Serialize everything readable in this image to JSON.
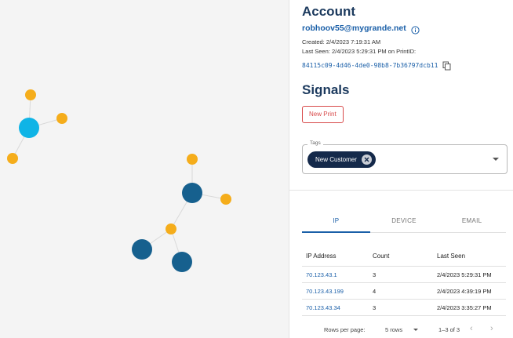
{
  "account": {
    "heading": "Account",
    "email": "robhoov55@mygrande.net",
    "created": "Created: 2/4/2023 7:19:31 AM",
    "last_seen": "Last Seen: 2/4/2023 5:29:31 PM on PrintID:",
    "print_id": "84115c09-4d46-4de0-98b8-7b36797dcb11"
  },
  "signals": {
    "heading": "Signals",
    "new_print_label": "New Print",
    "tags_label": "Tags",
    "tags": [
      "New Customer"
    ]
  },
  "tabs": [
    {
      "label": "IP",
      "active": true
    },
    {
      "label": "DEVICE",
      "active": false
    },
    {
      "label": "EMAIL",
      "active": false
    }
  ],
  "table": {
    "headers": [
      "IP Address",
      "Count",
      "Last Seen"
    ],
    "rows": [
      {
        "ip": "70.123.43.1",
        "count": "3",
        "last_seen": "2/4/2023 5:29:31 PM"
      },
      {
        "ip": "70.123.43.199",
        "count": "4",
        "last_seen": "2/4/2023 4:39:19 PM"
      },
      {
        "ip": "70.123.43.34",
        "count": "3",
        "last_seen": "2/4/2023 3:35:27 PM"
      }
    ]
  },
  "pagination": {
    "rows_per_page_label": "Rows per page:",
    "rows_value": "5 rows",
    "range": "1–3 of 3"
  },
  "colors": {
    "primary_node": "#0fb4e6",
    "secondary_node": "#16608e",
    "leaf_node": "#f5ad1b",
    "link": "#1a5fa8",
    "danger": "#d84a4a",
    "chip_bg": "#14294a"
  }
}
